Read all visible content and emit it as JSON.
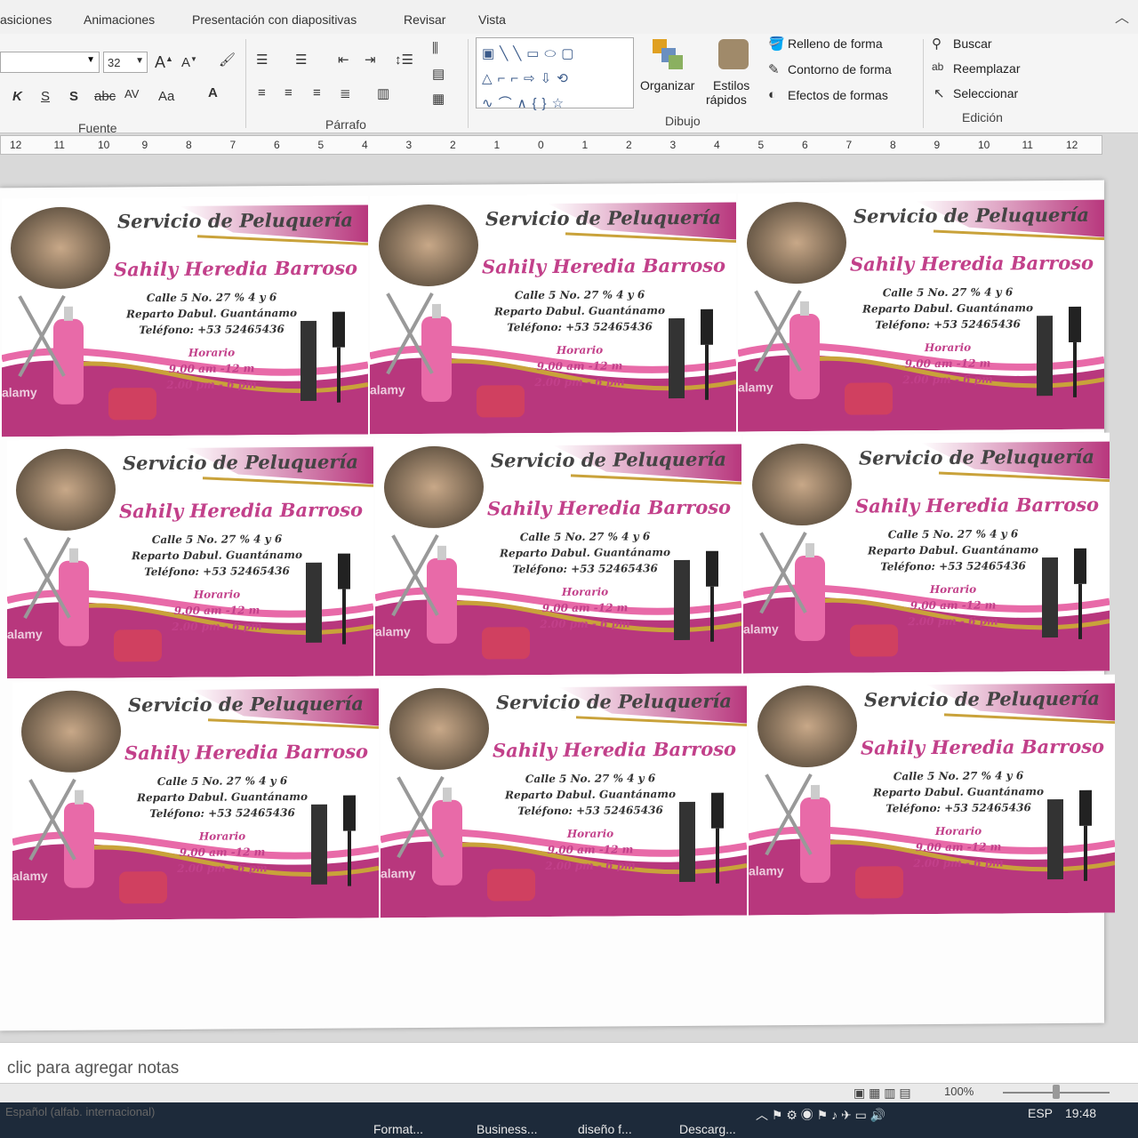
{
  "ribbon_tabs": [
    "asiciones",
    "Animaciones",
    "Presentación con diapositivas",
    "Revisar",
    "Vista"
  ],
  "font_group": {
    "label": "Fuente",
    "size": "32"
  },
  "paragraph_group": {
    "label": "Párrafo"
  },
  "drawing_group": {
    "label": "Dibujo",
    "organizar": "Organizar",
    "estilos_1": "Estilos",
    "estilos_2": "rápidos",
    "fill": "Relleno de forma",
    "outline": "Contorno de forma",
    "effects": "Efectos de formas"
  },
  "edit_group": {
    "label": "Edición",
    "find": "Buscar",
    "replace": "Reemplazar",
    "select": "Seleccionar"
  },
  "ruler_ticks": [
    "12",
    "11",
    "10",
    "9",
    "8",
    "7",
    "6",
    "5",
    "4",
    "3",
    "2",
    "1",
    "0",
    "1",
    "2",
    "3",
    "4",
    "5",
    "6",
    "7",
    "8",
    "9",
    "10",
    "11",
    "12"
  ],
  "card": {
    "title": "Servicio de Peluquería",
    "name": "Sahily Heredia Barroso",
    "address1": "Calle 5 No. 27 % 4 y 6",
    "address2": "Reparto Dabul. Guantánamo",
    "phone": "Teléfono: +53 52465436",
    "hours_label": "Horario",
    "hours1": "9.00 am -12 m",
    "hours2": "2.00 pm - 6 pm",
    "watermark": "alamy",
    "colors": {
      "magenta": "#b8377d",
      "pink": "#e86aa8",
      "gold": "#c9a23a"
    }
  },
  "notes_placeholder": "clic para agregar notas",
  "status": {
    "language": "Español (alfab. internacional)",
    "zoom": "100%"
  },
  "taskbar": {
    "items": [
      "Format...",
      "Business...",
      "diseño f...",
      "Descarg..."
    ],
    "lang": "ESP",
    "time": "19:48"
  }
}
